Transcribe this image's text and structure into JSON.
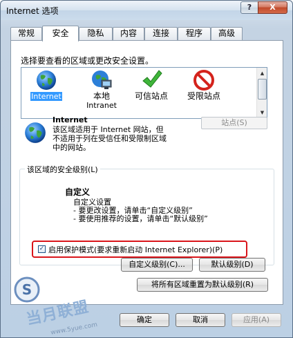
{
  "window": {
    "title": "Internet 选项",
    "help_glyph": "?",
    "close_glyph": "X"
  },
  "tabs": [
    {
      "label": "常规",
      "active": false
    },
    {
      "label": "安全",
      "active": true
    },
    {
      "label": "隐私",
      "active": false
    },
    {
      "label": "内容",
      "active": false
    },
    {
      "label": "连接",
      "active": false
    },
    {
      "label": "程序",
      "active": false
    },
    {
      "label": "高级",
      "active": false
    }
  ],
  "security": {
    "zone_prompt": "选择要查看的区域或更改安全设置。",
    "zones": [
      {
        "label": "Internet",
        "icon": "globe-icon",
        "selected": true
      },
      {
        "label": "本地",
        "label2": "Intranet",
        "icon": "local-intranet-icon",
        "selected": false
      },
      {
        "label": "可信站点",
        "icon": "checkmark-icon",
        "selected": false
      },
      {
        "label": "受限站点",
        "icon": "restricted-icon",
        "selected": false
      }
    ],
    "selected_zone": {
      "name": "Internet",
      "description": "该区域适用于 Internet 网站，但不适用于列在受信任和受限制区域中的网站。",
      "desc_lines": [
        "该区域适用于 Internet 网站，但",
        "不适用于列在受信任和受限制区域",
        "中的网站。"
      ]
    },
    "sites_button": "站点(S)",
    "level_group_title": "该区域的安全级别(L)",
    "custom_title": "自定义",
    "custom_lines": [
      "自定义设置",
      "- 要更改设置，请单击“自定义级别”",
      "- 要使用推荐的设置，请单击“默认级别”"
    ],
    "protected_mode": {
      "label": "启用保护模式(要求重新启动 Internet Explorer)(P)",
      "checked": true,
      "check_glyph": "✓"
    },
    "custom_level_button": "自定义级别(C)...",
    "default_level_button": "默认级别(D)",
    "reset_all_button": "将所有区域重置为默认级别(R)"
  },
  "footer": {
    "ok": "确定",
    "cancel": "取消",
    "apply": "应用(A)"
  },
  "watermark": {
    "text": "当月联盟",
    "url": "www.5yue.com",
    "letter": "S"
  },
  "colors": {
    "accent_red": "#d9141a",
    "selection_blue": "#3399ff",
    "panel_border": "#8c9bab"
  }
}
